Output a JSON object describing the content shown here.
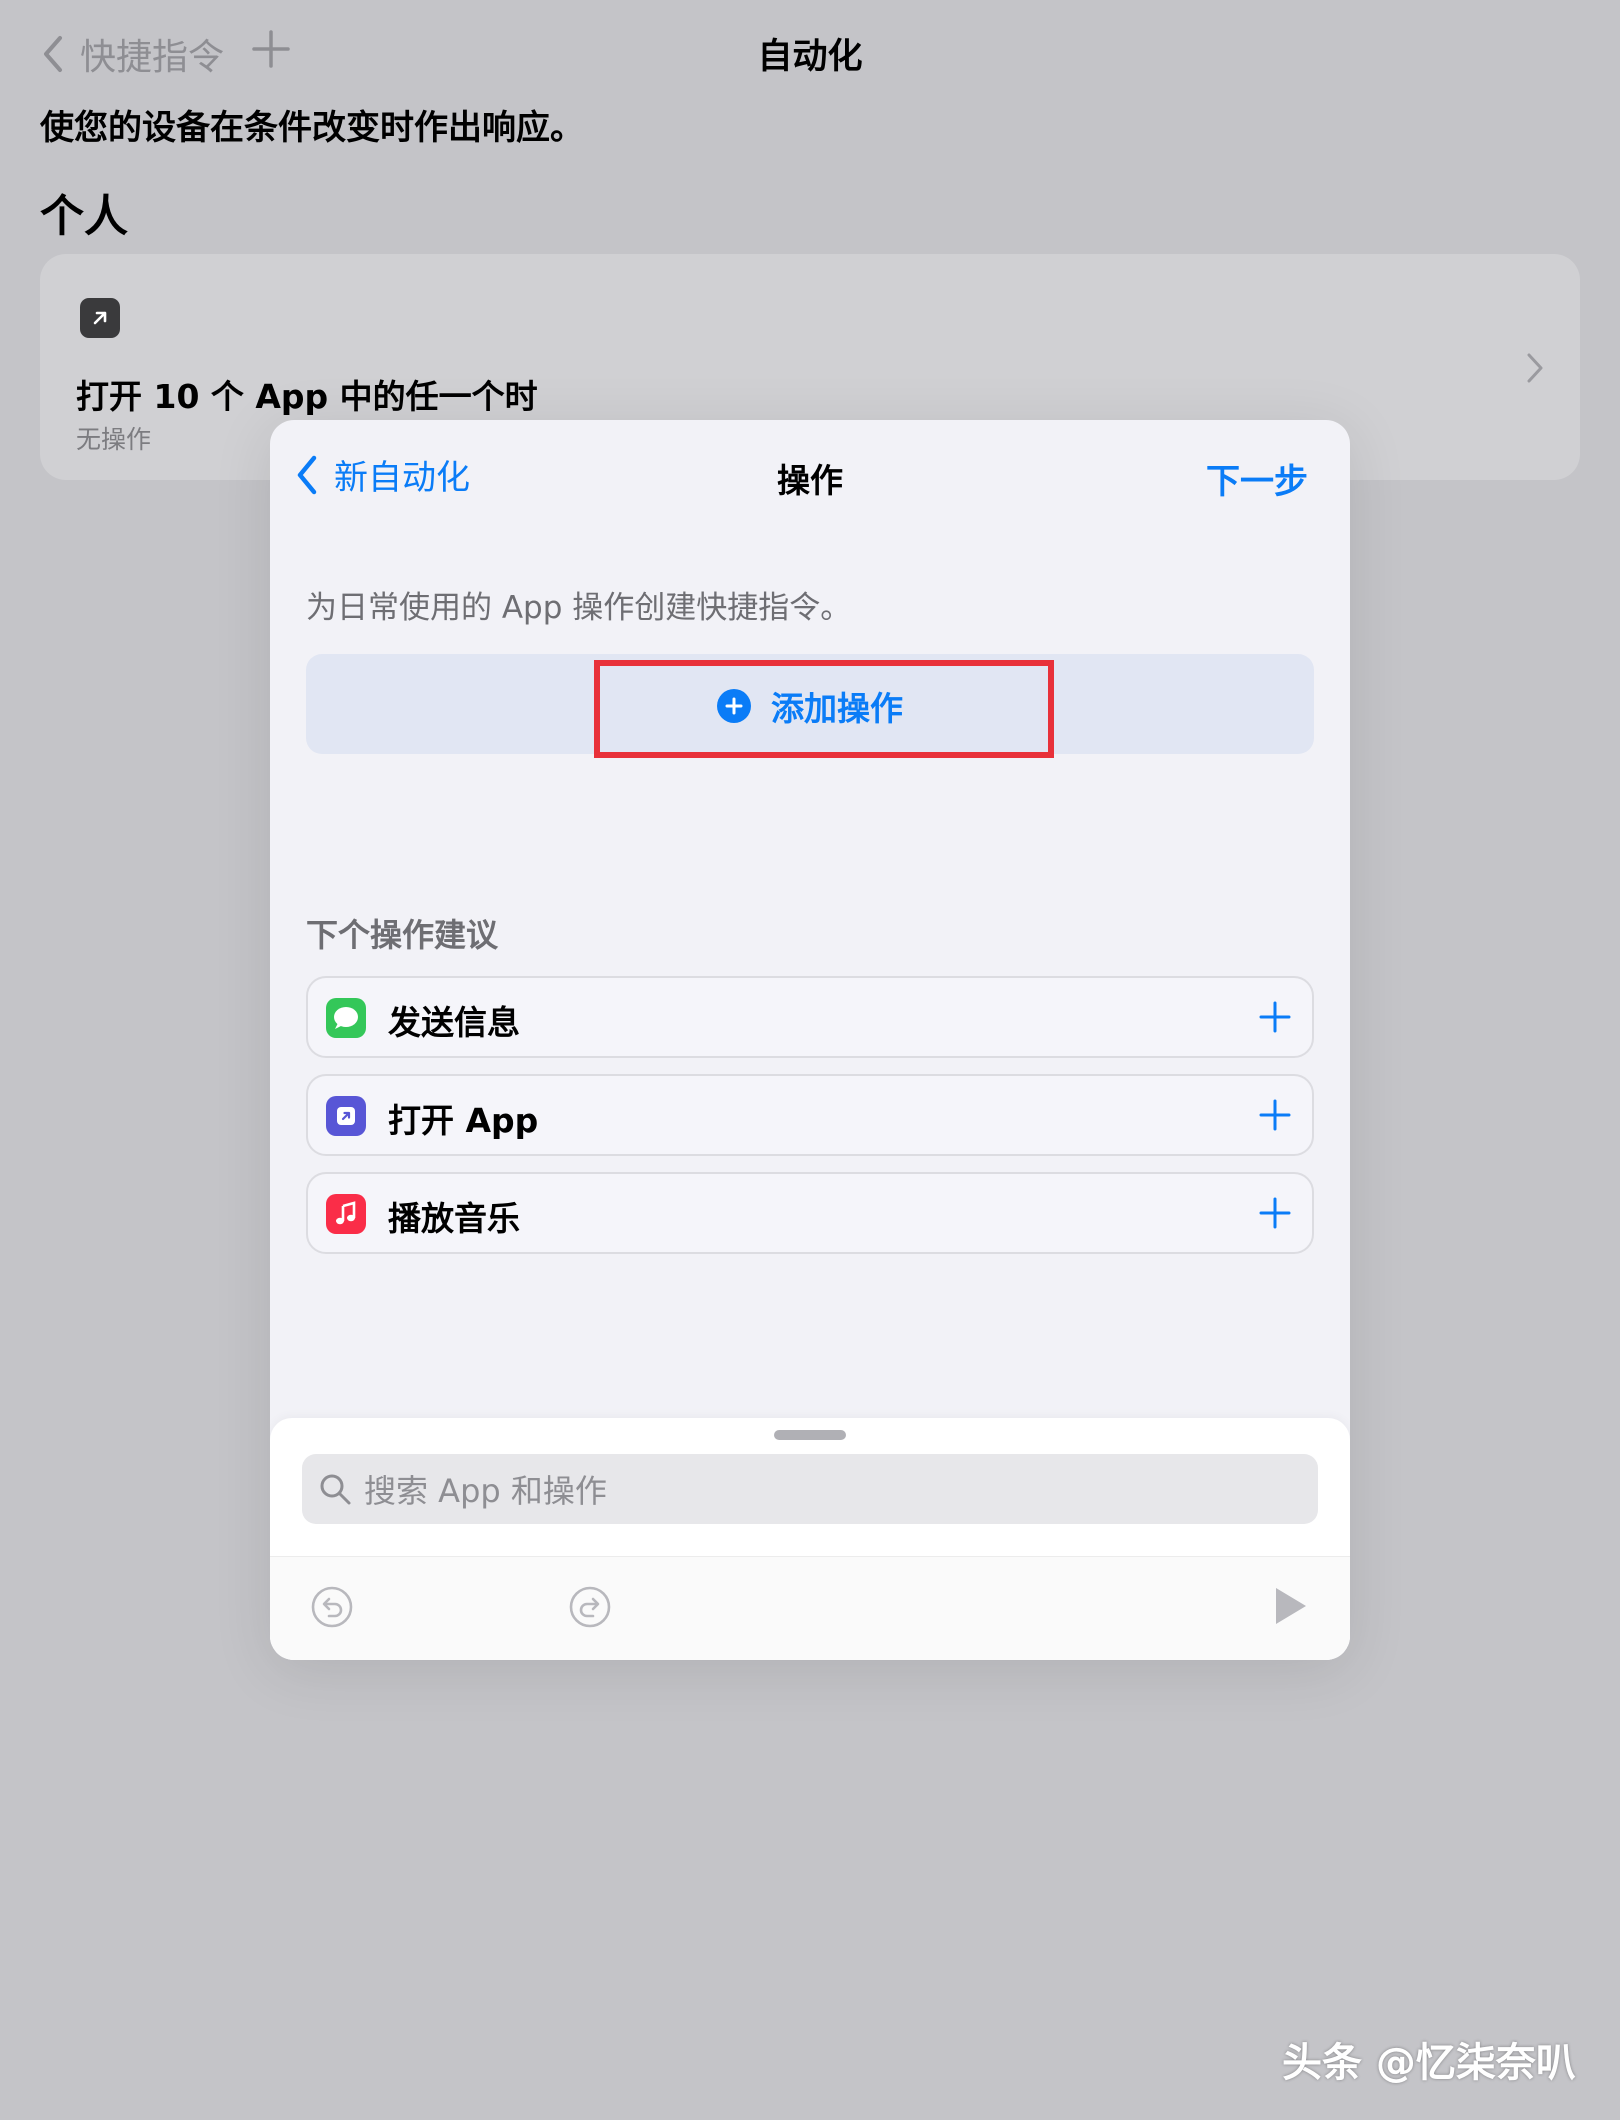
{
  "background": {
    "nav": {
      "back_label": "快捷指令",
      "title": "自动化"
    },
    "subtitle": "使您的设备在条件改变时作出响应。",
    "section_title": "个人",
    "card": {
      "title": "打开 10 个 App 中的任一个时",
      "subtitle": "无操作"
    }
  },
  "modal": {
    "back_label": "新自动化",
    "title": "操作",
    "next_label": "下一步",
    "description": "为日常使用的 App 操作创建快捷指令。",
    "add_action_label": "添加操作",
    "suggestions_title": "下个操作建议",
    "suggestions": [
      {
        "label": "发送信息",
        "icon": "messages-icon",
        "color": "#34c759"
      },
      {
        "label": "打开 App",
        "icon": "open-app-icon",
        "color": "#5856d6"
      },
      {
        "label": "播放音乐",
        "icon": "music-icon",
        "color": "#fa2d48"
      }
    ],
    "search_placeholder": "搜索 App 和操作"
  },
  "colors": {
    "accent": "#0a7cf7",
    "highlight": "#e8313a"
  },
  "watermark": "头条 @忆柒奈叭"
}
